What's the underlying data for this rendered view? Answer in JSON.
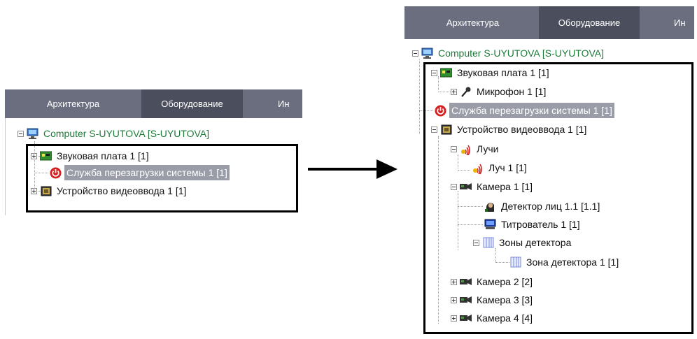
{
  "tabs": [
    "Архитектура",
    "Оборудование",
    "Ин"
  ],
  "root_label": "Computer S-UYUTOVA [S-UYUTOVA]",
  "left_tree": [
    {
      "label": "Звуковая плата 1 [1]",
      "icon": "sound-card-icon"
    },
    {
      "label": "Служба перезагрузки системы 1 [1]",
      "icon": "power-icon"
    },
    {
      "label": "Устройство видеоввода 1 [1]",
      "icon": "video-capture-icon"
    }
  ],
  "right_tree": [
    {
      "label": "Звуковая плата 1 [1]",
      "icon": "sound-card-icon"
    },
    {
      "label": "Микрофон 1 [1]",
      "icon": "microphone-icon"
    },
    {
      "label": "Служба перезагрузки системы 1 [1]",
      "icon": "power-icon"
    },
    {
      "label": "Устройство видеоввода 1 [1]",
      "icon": "video-capture-icon"
    },
    {
      "label": "Лучи",
      "icon": "rays-icon"
    },
    {
      "label": "Луч 1 [1]",
      "icon": "ray-icon"
    },
    {
      "label": "Камера 1 [1]",
      "icon": "camera-icon"
    },
    {
      "label": "Детектор лиц 1.1 [1.1]",
      "icon": "face-detector-icon"
    },
    {
      "label": "Титрователь 1 [1]",
      "icon": "titler-icon"
    },
    {
      "label": "Зоны детектора",
      "icon": "detector-zones-icon"
    },
    {
      "label": "Зона детектора 1 [1]",
      "icon": "detector-zone-icon"
    },
    {
      "label": "Камера 2 [2]",
      "icon": "camera-icon"
    },
    {
      "label": "Камера 3 [3]",
      "icon": "camera-icon"
    },
    {
      "label": "Камера 4 [4]",
      "icon": "camera-icon"
    }
  ],
  "colors": {
    "tabbar": "#6b6e7f",
    "active_tab": "#4b4e5c",
    "selection": "#9a9ca8",
    "root_text": "#1d7b3a"
  }
}
